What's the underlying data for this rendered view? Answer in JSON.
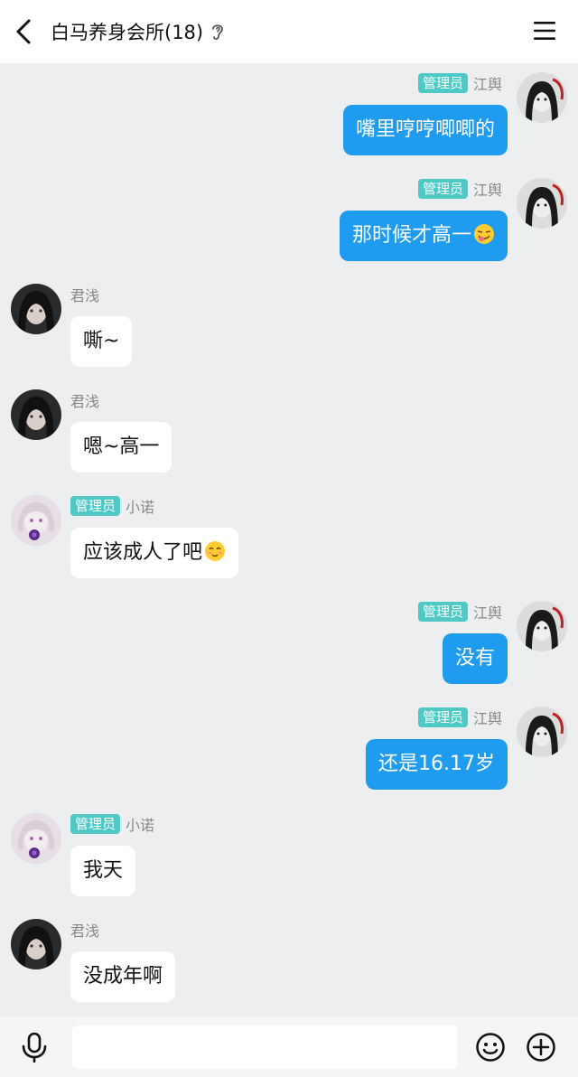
{
  "header": {
    "title": "白马养身会所(18)",
    "back_icon": "chevron-left-icon",
    "ear_icon": "ear-icon",
    "menu_icon": "hamburger-menu-icon"
  },
  "colors": {
    "bubble_self": "#1f9cf0",
    "bubble_other": "#ffffff",
    "badge": "#4ec9c6",
    "background": "#eceef0"
  },
  "messages": [
    {
      "side": "right",
      "badge": "管理员",
      "name": "江舆",
      "text": "嘴里哼哼唧唧的",
      "emoji": ""
    },
    {
      "side": "right",
      "badge": "管理员",
      "name": "江舆",
      "text": "那时候才高一",
      "emoji": "tongue-face-emoji"
    },
    {
      "side": "left",
      "badge": "",
      "name": "君浅",
      "text": "嘶~",
      "emoji": ""
    },
    {
      "side": "left",
      "badge": "",
      "name": "君浅",
      "text": "嗯~高一",
      "emoji": ""
    },
    {
      "side": "left",
      "badge": "管理员",
      "name": "小诺",
      "text": "应该成人了吧",
      "emoji": "shy-smile-emoji"
    },
    {
      "side": "right",
      "badge": "管理员",
      "name": "江舆",
      "text": "没有",
      "emoji": ""
    },
    {
      "side": "right",
      "badge": "管理员",
      "name": "江舆",
      "text": "还是16.17岁",
      "emoji": ""
    },
    {
      "side": "left",
      "badge": "管理员",
      "name": "小诺",
      "text": "我天",
      "emoji": ""
    },
    {
      "side": "left",
      "badge": "",
      "name": "君浅",
      "text": "没成年啊",
      "emoji": ""
    }
  ],
  "input_bar": {
    "placeholder": "",
    "mic_icon": "microphone-icon",
    "emoji_icon": "smiley-icon",
    "plus_icon": "plus-circle-icon"
  }
}
